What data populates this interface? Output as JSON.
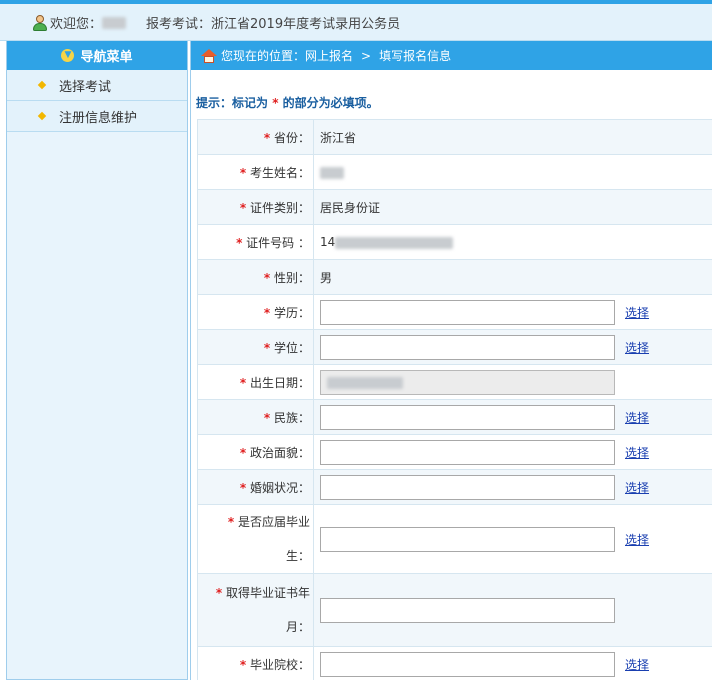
{
  "header": {
    "welcome_label": "欢迎您：",
    "exam_label": "报考考试：浙江省2019年度考试录用公务员",
    "colors": {
      "accent": "#2fa3e6",
      "header_bg": "#e3f2fb"
    }
  },
  "sidebar": {
    "title": "导航菜单",
    "items": [
      {
        "label": "选择考试"
      },
      {
        "label": "注册信息维护"
      }
    ]
  },
  "breadcrumb": {
    "prefix": "您现在的位置：网上报名",
    "separator": ">",
    "current": "填写报名信息"
  },
  "hint": {
    "before": "提示：标记为",
    "star": "*",
    "after": "的部分为必填项。"
  },
  "form": {
    "star": "*",
    "choose_label": "选择",
    "rows": [
      {
        "label": "省份：",
        "value": "浙江省"
      },
      {
        "label": "考生姓名：",
        "value": ""
      },
      {
        "label": "证件类别：",
        "value": "居民身份证"
      },
      {
        "label": "证件号码 ：",
        "value": "14"
      },
      {
        "label": "性别：",
        "value": "男"
      },
      {
        "label": "学历：",
        "value": ""
      },
      {
        "label": "学位：",
        "value": ""
      },
      {
        "label": "出生日期：",
        "value": ""
      },
      {
        "label": "民族：",
        "value": ""
      },
      {
        "label": "政治面貌：",
        "value": ""
      },
      {
        "label": "婚姻状况：",
        "value": ""
      },
      {
        "label_line1": "是否应届毕业",
        "label_line2": "生：",
        "value": ""
      },
      {
        "label_line1": "取得毕业证书年",
        "label_line2": "月：",
        "value": ""
      },
      {
        "label": "毕业院校：",
        "value": ""
      }
    ]
  }
}
